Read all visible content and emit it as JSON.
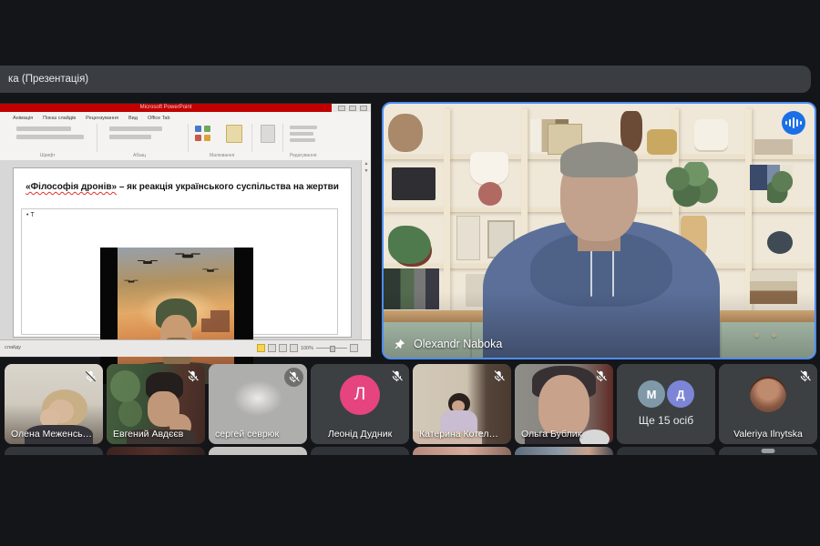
{
  "share_bar": {
    "label": "ка (Презентація)"
  },
  "main_tile": {
    "name": "Olexandr Naboka"
  },
  "presentation": {
    "window_title": "Microsoft PowerPoint",
    "ribbon_tabs": [
      "Анімація",
      "Показ слайдів",
      "Рецензування",
      "Вид",
      "Office Tab"
    ],
    "ribbon_groups": [
      "Шрифт",
      "Абзац",
      "Малювання",
      "Редагування"
    ],
    "slide": {
      "title_accent": "«Філософія дронів»",
      "title_rest": " – як реакція українського суспільства на жертви",
      "bullet_marker": "•",
      "bullet": "Т"
    },
    "status": {
      "left": "слайду",
      "zoom": "100%"
    }
  },
  "participants": [
    {
      "name": "Олена Меженсь…",
      "muted": true
    },
    {
      "name": "Евгений Авдєєв",
      "muted": true
    },
    {
      "name": "сергей севрюк",
      "muted": true
    },
    {
      "name": "Леонід Дудник",
      "muted": true,
      "avatar_letter": "Л",
      "avatar_color": "#E5447E"
    },
    {
      "name": "Катерина Котел…",
      "muted": true
    },
    {
      "name": "Ольга Бублик",
      "muted": true
    },
    {
      "name": "Ще 15 осіб",
      "overflow": true,
      "avatars": [
        {
          "letter": "М",
          "color": "#7F99A8"
        },
        {
          "letter": "Д",
          "color": "#7C85D6"
        }
      ]
    },
    {
      "name": "Valeriya Ilnytska",
      "muted": true
    }
  ],
  "colors": {
    "accent_blue": "#4C8DF6",
    "speaking_badge": "#1A6FE8",
    "tile_bg": "#3C4043",
    "ppt_titlebar_red": "#C00000",
    "pink_avatar": "#E5447E",
    "avatar_m": "#7F99A8",
    "avatar_d": "#7C85D6"
  }
}
